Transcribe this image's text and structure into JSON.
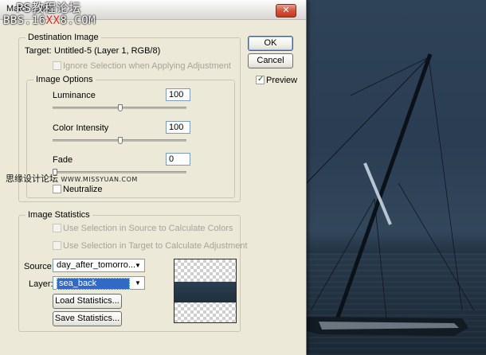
{
  "dialog": {
    "title": "Match Color",
    "close_glyph": "✕",
    "watermark_top_line1": "PS教程论坛",
    "watermark_top_prefix": "BBS.16",
    "watermark_top_red": "XX",
    "watermark_top_suffix": "8.COM",
    "watermark_mid_text": "思缘设计论坛",
    "watermark_mid_site": "WWW.MISSYUAN.COM"
  },
  "buttons": {
    "ok": "OK",
    "cancel": "Cancel",
    "load_statistics": "Load Statistics...",
    "save_statistics": "Save Statistics..."
  },
  "preview": {
    "label": "Preview",
    "checked": true
  },
  "destination": {
    "legend": "Destination Image",
    "target_label": "Target:",
    "target_value": "Untitled-5 (Layer 1, RGB/8)",
    "ignore_selection": "Ignore Selection when Applying Adjustment"
  },
  "image_options": {
    "legend": "Image Options",
    "luminance_label": "Luminance",
    "luminance_value": "100",
    "color_intensity_label": "Color Intensity",
    "color_intensity_value": "100",
    "fade_label": "Fade",
    "fade_value": "0",
    "neutralize_label": "Neutralize"
  },
  "image_statistics": {
    "legend": "Image Statistics",
    "use_selection_source": "Use Selection in Source to Calculate Colors",
    "use_selection_target": "Use Selection in Target to Calculate Adjustment",
    "source_label": "Source:",
    "source_value": "day_after_tomorro...",
    "layer_label": "Layer:",
    "layer_value": "sea_back"
  },
  "icons": {
    "close": "close-icon",
    "dropdown": "chevron-down-icon",
    "check": "checkmark-icon"
  },
  "colors": {
    "dialog_bg": "#ece9d8",
    "selection_blue": "#316ac5",
    "close_red": "#c23a22"
  }
}
